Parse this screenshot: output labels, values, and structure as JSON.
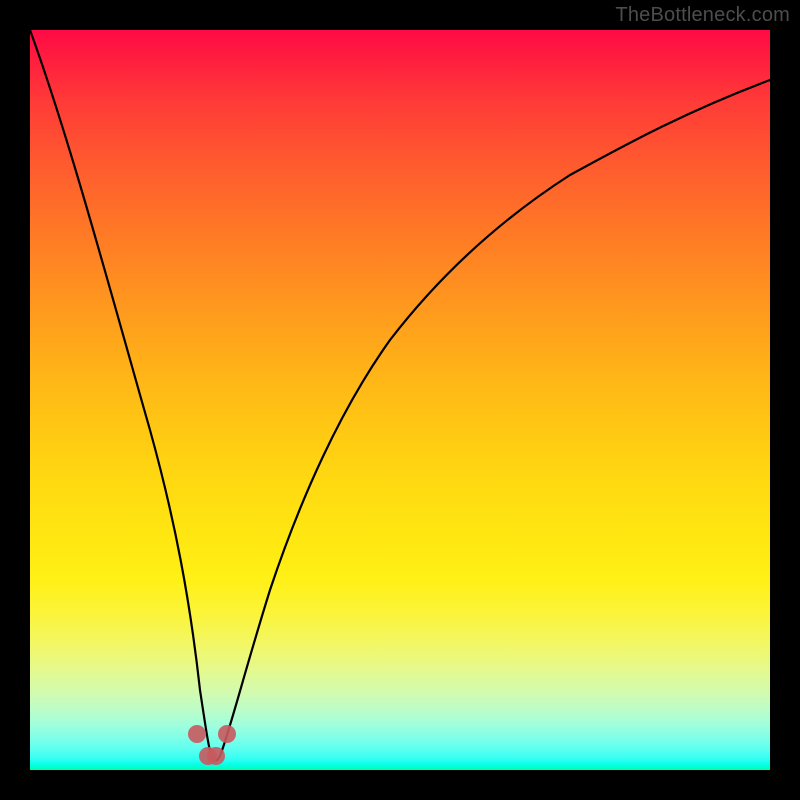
{
  "attribution": "TheBottleneck.com",
  "chart_data": {
    "type": "line",
    "title": "",
    "xlabel": "",
    "ylabel": "",
    "xlim": [
      0,
      1
    ],
    "ylim": [
      0,
      1
    ],
    "series": [
      {
        "name": "bottleneck-curve",
        "x": [
          0.0,
          0.02,
          0.04,
          0.06,
          0.08,
          0.1,
          0.12,
          0.14,
          0.16,
          0.18,
          0.2,
          0.22,
          0.235,
          0.245,
          0.255,
          0.27,
          0.3,
          0.34,
          0.38,
          0.42,
          0.46,
          0.5,
          0.55,
          0.6,
          0.65,
          0.7,
          0.75,
          0.8,
          0.85,
          0.9,
          0.95,
          1.0
        ],
        "y": [
          1.0,
          0.92,
          0.84,
          0.76,
          0.67,
          0.58,
          0.49,
          0.4,
          0.31,
          0.22,
          0.13,
          0.06,
          0.02,
          0.005,
          0.02,
          0.06,
          0.17,
          0.3,
          0.41,
          0.5,
          0.58,
          0.645,
          0.71,
          0.76,
          0.8,
          0.835,
          0.865,
          0.89,
          0.91,
          0.925,
          0.938,
          0.95
        ]
      }
    ],
    "markers": {
      "name": "highlight-points",
      "color": "#c9595e",
      "points": [
        {
          "x": 0.225,
          "y": 0.045
        },
        {
          "x": 0.24,
          "y": 0.015
        },
        {
          "x": 0.25,
          "y": 0.015
        },
        {
          "x": 0.265,
          "y": 0.045
        }
      ]
    },
    "background_gradient": {
      "top_color": "#ff0a44",
      "mid_color": "#ffe611",
      "bottom_color": "#00ffa9"
    }
  }
}
